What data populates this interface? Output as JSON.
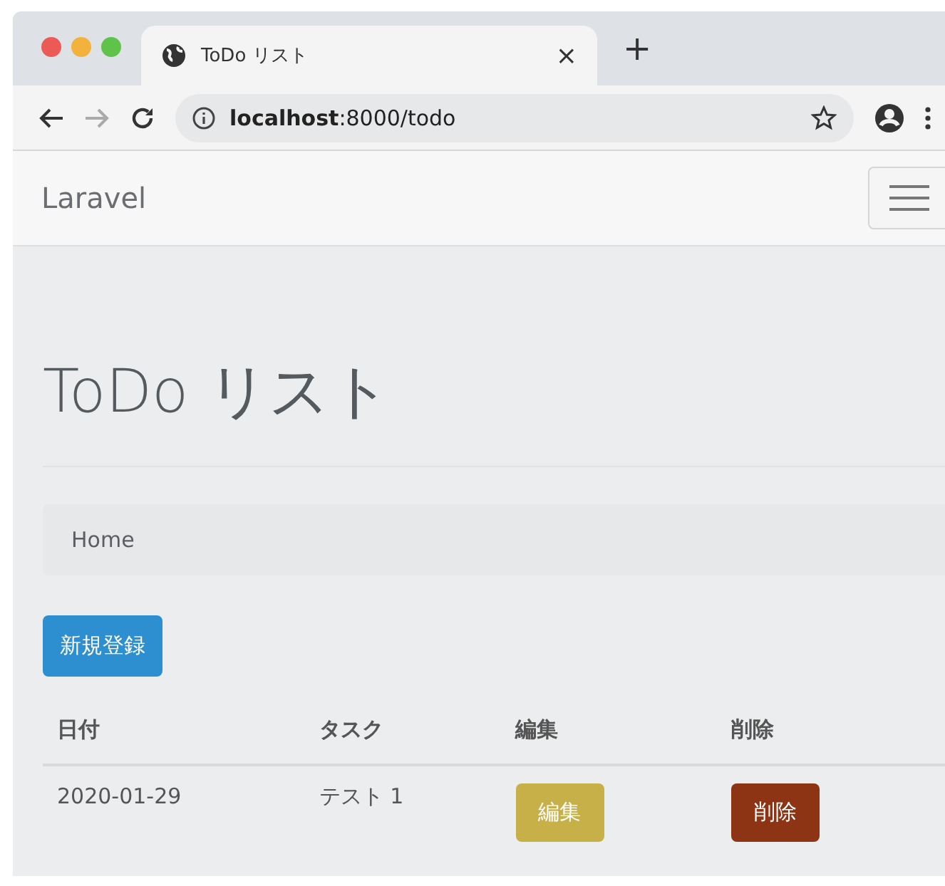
{
  "browser": {
    "tab_title": "ToDo リスト",
    "tab_close": "×",
    "new_tab": "+",
    "address": "**localhost**:8000/todo"
  },
  "navbar": {
    "brand": "Laravel"
  },
  "page": {
    "title": "ToDo リスト",
    "breadcrumb": [
      "Home"
    ],
    "new_button": "新規登録"
  },
  "table": {
    "columns": [
      "日付",
      "タスク",
      "編集",
      "削除"
    ],
    "rows": [
      {
        "date": "2020-01-29",
        "task": "テスト 1",
        "edit": "編集",
        "delete": "削除"
      }
    ]
  }
}
